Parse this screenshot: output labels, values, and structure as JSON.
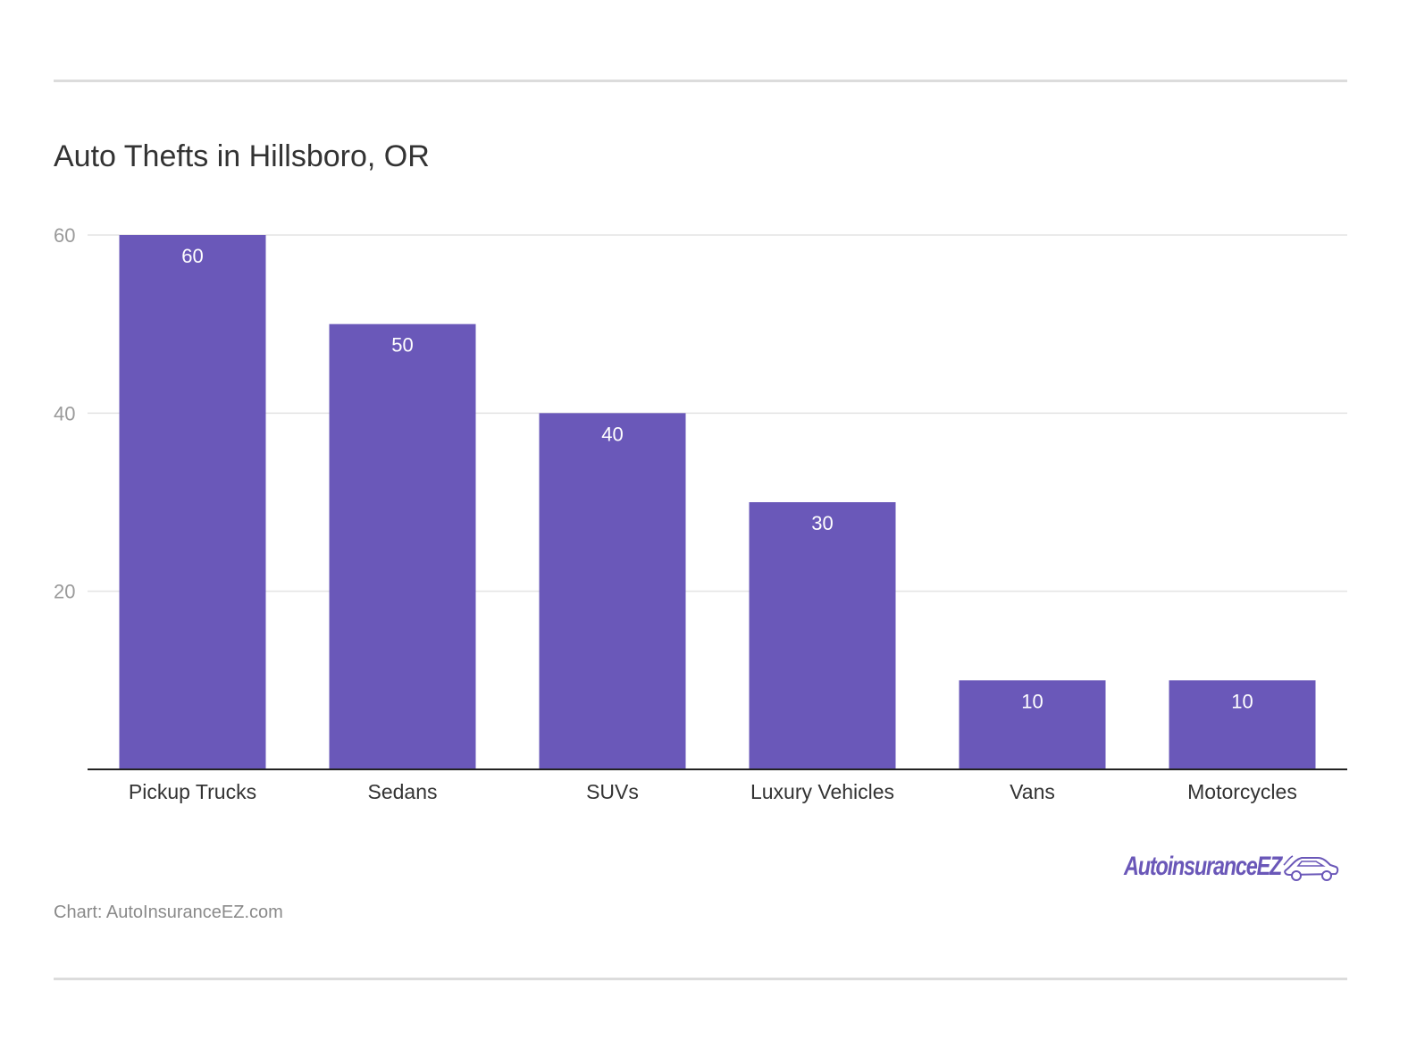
{
  "colors": {
    "bar": "#6a58b9",
    "grid": "#e3e3e3",
    "axis": "#222222"
  },
  "logo": {
    "text": "AutoinsuranceEZ",
    "icon": "car-icon"
  },
  "source": "Chart: AutoInsuranceEZ.com",
  "chart_data": {
    "type": "bar",
    "title": "Auto Thefts in Hillsboro, OR",
    "categories": [
      "Pickup Trucks",
      "Sedans",
      "SUVs",
      "Luxury Vehicles",
      "Vans",
      "Motorcycles"
    ],
    "values": [
      60,
      50,
      40,
      30,
      10,
      10
    ],
    "data_labels": [
      "60",
      "50",
      "40",
      "30",
      "10",
      "10"
    ],
    "yticks": [
      20,
      40,
      60
    ],
    "ytick_labels": [
      "20",
      "40",
      "60"
    ],
    "ylim": [
      0,
      60
    ],
    "xlabel": "",
    "ylabel": "",
    "grid": true,
    "legend": "none"
  }
}
